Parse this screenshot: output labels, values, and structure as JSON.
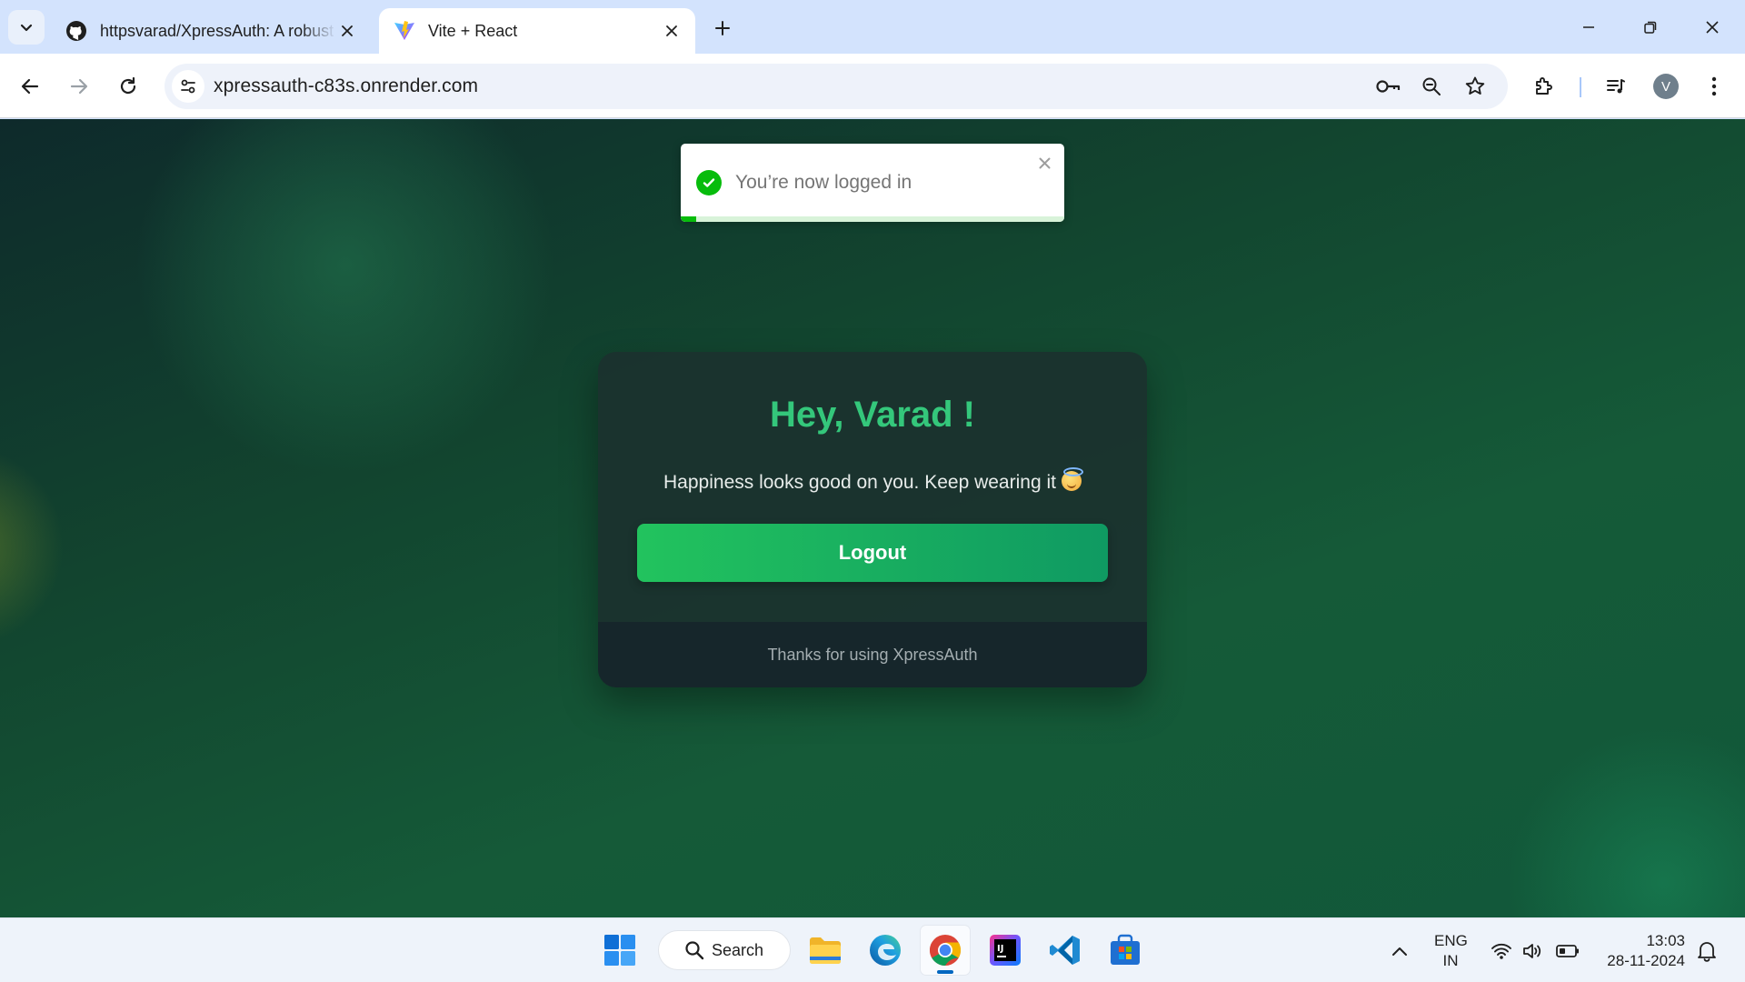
{
  "browser": {
    "tabs": [
      {
        "title": "httpsvarad/XpressAuth: A robust",
        "icon": "github-icon",
        "active": false
      },
      {
        "title": "Vite + React",
        "icon": "vite-icon",
        "active": true
      }
    ],
    "url": "xpressauth-c83s.onrender.com",
    "profile_initial": "V"
  },
  "toast": {
    "message": "You’re now logged in",
    "type": "success",
    "progress": 0.04
  },
  "card": {
    "greeting": "Hey, Varad !",
    "tagline": "Happiness looks good on you. Keep wearing it",
    "emoji_icon": "smiling-face-with-halo-icon",
    "logout_label": "Logout",
    "footer": "Thanks for using XpressAuth"
  },
  "taskbar": {
    "search_label": "Search",
    "apps": [
      "windows-start-icon",
      "file-explorer-icon",
      "edge-icon",
      "chrome-icon",
      "intellij-icon",
      "vscode-icon",
      "microsoft-store-icon"
    ],
    "active_app": "chrome-icon",
    "lang_line1": "ENG",
    "lang_line2": "IN",
    "time": "13:03",
    "date": "28-11-2024"
  },
  "colors": {
    "accent_green": "#34c77b",
    "toast_success": "#07bc0c",
    "browser_frame": "#d3e3fd"
  }
}
